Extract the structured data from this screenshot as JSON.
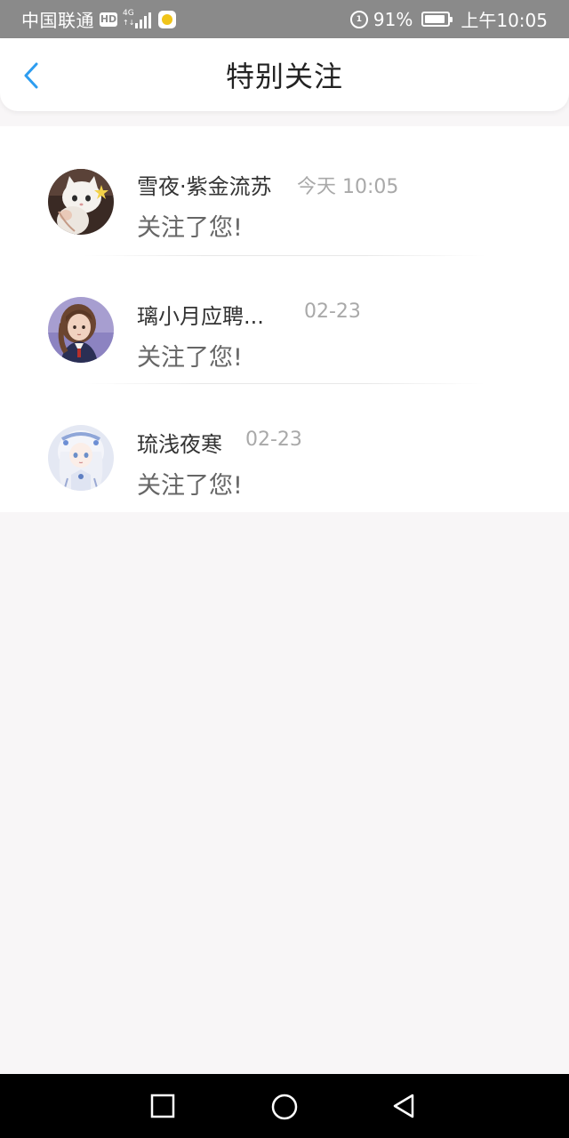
{
  "status_bar": {
    "carrier": "中国联通",
    "hd": "HD",
    "network": "4G",
    "network_sub": "↑↓",
    "data_saver": "1",
    "battery": "91%",
    "time": "上午10:05"
  },
  "header": {
    "title": "特别关注",
    "back_icon": "chevron-left-icon",
    "accent": "#2d9df0"
  },
  "list": {
    "items": [
      {
        "name": "雪夜·紫金流苏",
        "time": "今天 10:05",
        "message": "关注了您!",
        "avatar": "white-cat-avatar"
      },
      {
        "name": "璃小月应聘...",
        "time": "02-23",
        "message": "关注了您!",
        "avatar": "anime-girl-brown-hair-avatar"
      },
      {
        "name": "琉浅夜寒",
        "time": "02-23",
        "message": "关注了您!",
        "avatar": "anime-girl-white-hair-avatar"
      }
    ]
  },
  "nav_bar": {
    "recent_icon": "square-icon",
    "home_icon": "circle-icon",
    "back_icon": "triangle-back-icon"
  }
}
